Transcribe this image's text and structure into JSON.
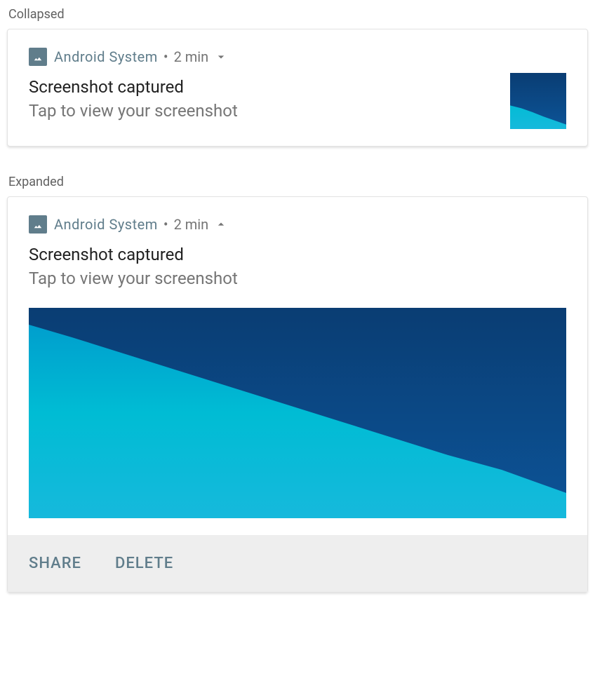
{
  "section_labels": {
    "collapsed": "Collapsed",
    "expanded": "Expanded"
  },
  "notification": {
    "app_name": "Android  System",
    "separator": "•",
    "timestamp": "2 min",
    "title": "Screenshot captured",
    "subtitle": "Tap to view your screenshot",
    "thumbnail_alt": "screenshot-thumbnail",
    "picture_alt": "screenshot-big-picture",
    "actions": {
      "share": "Share",
      "delete": "Delete"
    }
  }
}
